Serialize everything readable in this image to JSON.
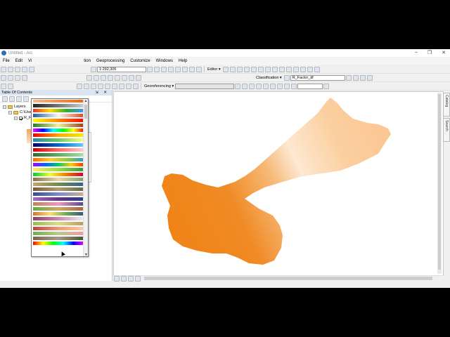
{
  "window": {
    "title": "Untitled - Arc",
    "controls": [
      "–",
      "❐",
      "✕"
    ]
  },
  "menu": [
    "File",
    "Edit",
    "Vi",
    "tion",
    "Geoprocessing",
    "Customize",
    "Windows",
    "Help"
  ],
  "toolbar": {
    "scale_value": "1:292,305",
    "editor_label": "Editor ▾",
    "classification_label": "Classification ▾",
    "layer_select_value": "R_Factor_tif",
    "georeferencing_label": "Georeferencing ▾"
  },
  "toc": {
    "title": "Table Of Contents",
    "header_controls": "⇲ ✕",
    "layers_label": "Layers",
    "folder_label": "C:\\Use",
    "layer_label": "R_F"
  },
  "side_tabs": [
    "Catalog",
    "Search"
  ],
  "colors": {
    "map_background": "#ffffff",
    "raster_dark": "#f08418",
    "raster_light": "#fde8d2"
  }
}
